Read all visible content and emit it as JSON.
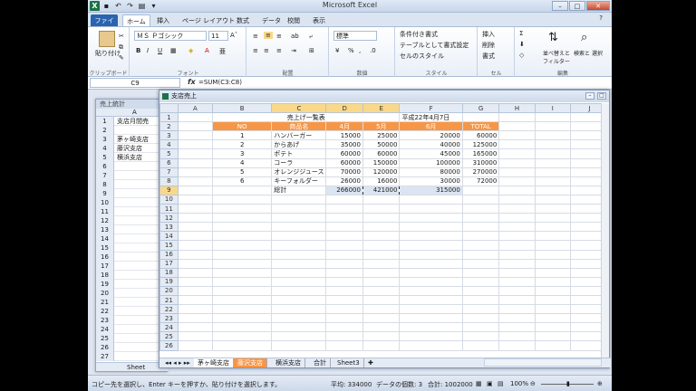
{
  "window": {
    "title": "Microsoft Excel",
    "accent": "#1e7145"
  },
  "ribbon_tabs": [
    "ファイル",
    "ホーム",
    "挿入",
    "ページ レイアウト",
    "数式",
    "データ",
    "校閲",
    "表示"
  ],
  "ribbon": {
    "paste": "貼り付け",
    "clipboard": "クリップボード",
    "font_name": "ＭＳ Ｐゴシック",
    "font_size": "11",
    "font_group": "フォント",
    "align_group": "配置",
    "number_format": "標準",
    "number_group": "数値",
    "conditional": "条件付き書式",
    "format_table": "テーブルとして書式設定",
    "cell_style": "セルのスタイル",
    "style_group": "スタイル",
    "insert": "挿入",
    "delete": "削除",
    "format": "書式",
    "cell_group": "セル",
    "sort_filter": "並べ替えと フィルター",
    "find_select": "検索と 選択",
    "edit_group": "編集",
    "percent": "%",
    "comma": ","
  },
  "formula_bar": {
    "name_box": "C9",
    "fx": "fx",
    "formula": "=SUM(C3:C8)"
  },
  "back_window": {
    "title": "売上統計",
    "col": "A",
    "rows": [
      {
        "n": "1",
        "v": "支店月間売"
      },
      {
        "n": "2",
        "v": ""
      },
      {
        "n": "3",
        "v": "茅ヶ崎支店"
      },
      {
        "n": "4",
        "v": "藤沢支店"
      },
      {
        "n": "5",
        "v": "横浜支店"
      },
      {
        "n": "6",
        "v": ""
      },
      {
        "n": "7",
        "v": ""
      },
      {
        "n": "8",
        "v": ""
      },
      {
        "n": "9",
        "v": ""
      },
      {
        "n": "10",
        "v": ""
      },
      {
        "n": "11",
        "v": ""
      },
      {
        "n": "12",
        "v": ""
      },
      {
        "n": "13",
        "v": ""
      },
      {
        "n": "14",
        "v": ""
      },
      {
        "n": "15",
        "v": ""
      },
      {
        "n": "16",
        "v": ""
      },
      {
        "n": "17",
        "v": ""
      },
      {
        "n": "18",
        "v": ""
      },
      {
        "n": "19",
        "v": ""
      },
      {
        "n": "20",
        "v": ""
      },
      {
        "n": "21",
        "v": ""
      },
      {
        "n": "22",
        "v": ""
      },
      {
        "n": "23",
        "v": ""
      },
      {
        "n": "24",
        "v": ""
      },
      {
        "n": "25",
        "v": ""
      },
      {
        "n": "26",
        "v": ""
      },
      {
        "n": "27",
        "v": ""
      }
    ],
    "tab": "Sheet"
  },
  "front_window": {
    "title": "支店売上",
    "columns": [
      "A",
      "B",
      "C",
      "D",
      "E",
      "F",
      "G",
      "H",
      "I",
      "J"
    ],
    "sheet_title": "売上げ一覧表",
    "date": "平成22年4月7日",
    "header": [
      "NO",
      "商品名",
      "4月",
      "5月",
      "6月",
      "TOTAL"
    ],
    "rows": [
      [
        "1",
        "ハンバーガー",
        "15000",
        "25000",
        "20000",
        "60000"
      ],
      [
        "2",
        "からあげ",
        "35000",
        "50000",
        "40000",
        "125000"
      ],
      [
        "3",
        "ポテト",
        "60000",
        "60000",
        "45000",
        "165000"
      ],
      [
        "4",
        "コーラ",
        "60000",
        "150000",
        "100000",
        "310000"
      ],
      [
        "5",
        "オレンジジュース",
        "70000",
        "120000",
        "80000",
        "270000"
      ],
      [
        "6",
        "キーフォルダー",
        "26000",
        "16000",
        "30000",
        "72000"
      ]
    ],
    "total_row": [
      "総計",
      "266000",
      "421000",
      "315000"
    ],
    "row_numbers": [
      "1",
      "2",
      "3",
      "4",
      "5",
      "6",
      "7",
      "8",
      "9",
      "10",
      "11",
      "12",
      "13",
      "14",
      "15",
      "16",
      "17",
      "18",
      "19",
      "20",
      "21",
      "22",
      "23",
      "24",
      "25",
      "26"
    ],
    "sheet_tabs": [
      "茅ヶ崎支店",
      "藤沢支店",
      "横浜支店",
      "合計",
      "Sheet3"
    ]
  },
  "status": {
    "message": "コピー先を選択し、Enter キーを押すか、貼り付けを選択します。",
    "average": "平均: 334000",
    "count": "データの個数: 3",
    "sum": "合計: 1002000",
    "zoom": "100%"
  }
}
